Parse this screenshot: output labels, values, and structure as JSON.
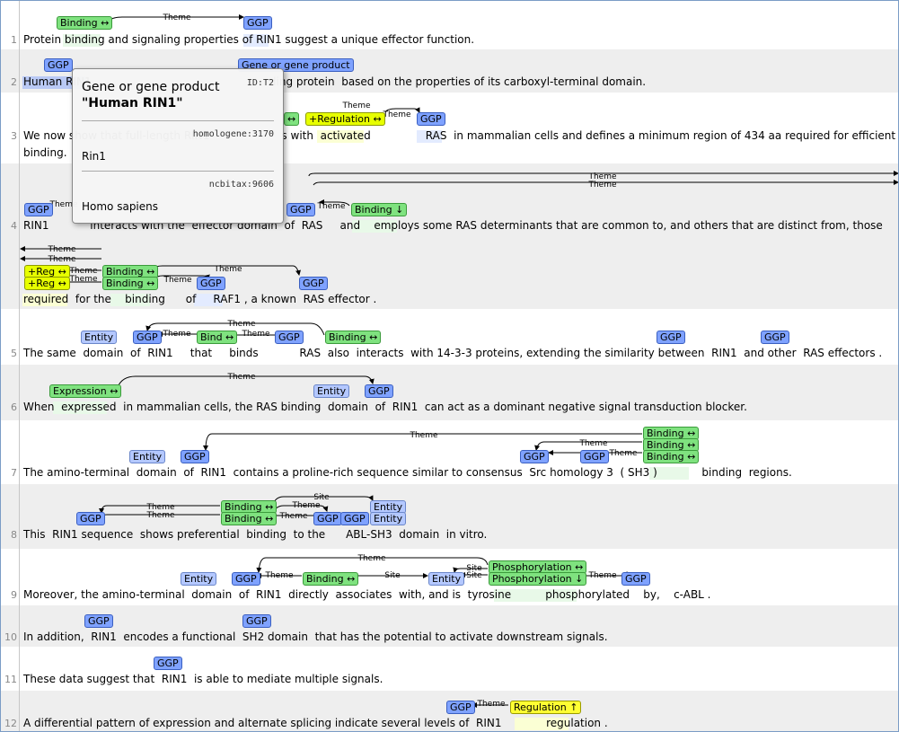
{
  "sentences": [
    {
      "n": "1",
      "text": "Protein binding and signaling properties of RIN1 suggest a unique effector function."
    },
    {
      "n": "2",
      "text": "Human RIN1                                                    ding protein  based on the properties of its carboxyl-terminal domain."
    },
    {
      "n": "3a",
      "num": "3",
      "text": "We now show that full-length RIN1                     s with  activated                RAS  in mammalian cells and defines a minimum region of 434 aa required for efficient RAS"
    },
    {
      "n": "3b",
      "text": "binding."
    },
    {
      "n": "4a",
      "num": "4",
      "text": "RIN1            interacts with the  effector domain  of  RAS     and    employs some RAS determinants that are common to, and others that are distinct from, those"
    },
    {
      "n": "4b",
      "text": "required  for the    binding      of     RAF1 , a known  RAS effector ."
    },
    {
      "n": "5",
      "text": "The same  domain  of  RIN1     that     binds            RAS  also  interacts  with 14-3-3 proteins, extending the similarity between  RIN1  and other  RAS effectors ."
    },
    {
      "n": "6",
      "text": "When  expressed  in mammalian cells, the RAS binding  domain  of  RIN1  can act as a dominant negative signal transduction blocker."
    },
    {
      "n": "7",
      "text": "The amino-terminal  domain  of  RIN1  contains a proline-rich sequence similar to consensus  Src homology 3  ( SH3 )             binding  regions."
    },
    {
      "n": "8",
      "text": "This  RIN1 sequence  shows preferential  binding  to the      ABL-SH3  domain  in vitro."
    },
    {
      "n": "9",
      "text": "Moreover, the amino-terminal  domain  of  RIN1  directly  associates  with, and is  tyrosine          phosphorylated    by,    c-ABL ."
    },
    {
      "n": "10",
      "text": "In addition,  RIN1  encodes a functional  SH2 domain  that has the potential to activate downstream signals."
    },
    {
      "n": "11",
      "text": "These data suggest that  RIN1  is able to mediate multiple signals."
    },
    {
      "n": "12",
      "text": "A differential pattern of expression and alternate splicing indicate several levels of  RIN1             regulation ."
    }
  ],
  "labels": {
    "ggp": "GGP",
    "entity": "Entity",
    "binding_arrow": "Binding ↔",
    "binding_down": "Binding ↓",
    "bind_arrow": "Bind ↔",
    "gene_product": "Gene or gene product",
    "pos_reg": "+Regulation ↔",
    "reg_short": "+Reg ↔",
    "expression": "Expression ↔",
    "phos_arrow": "Phosphorylation ↔",
    "phos_down": "Phosphorylation ↓",
    "regulation_up": "Regulation ↑",
    "theme": "Theme",
    "site": "Site"
  },
  "tooltip": {
    "type": "Gene or gene product",
    "name": "\"Human RIN1\"",
    "id": "ID:T2",
    "ref1": "homologene:3170",
    "val1": "Rin1",
    "ref2": "ncbitax:9606",
    "val2": "Homo sapiens"
  },
  "colors": {
    "ggp": "#7fa2ff",
    "entity": "#b4c8ff",
    "event": "#7fe27f",
    "regulation": "#e7ff00",
    "alt_row": "#eeeeee"
  }
}
